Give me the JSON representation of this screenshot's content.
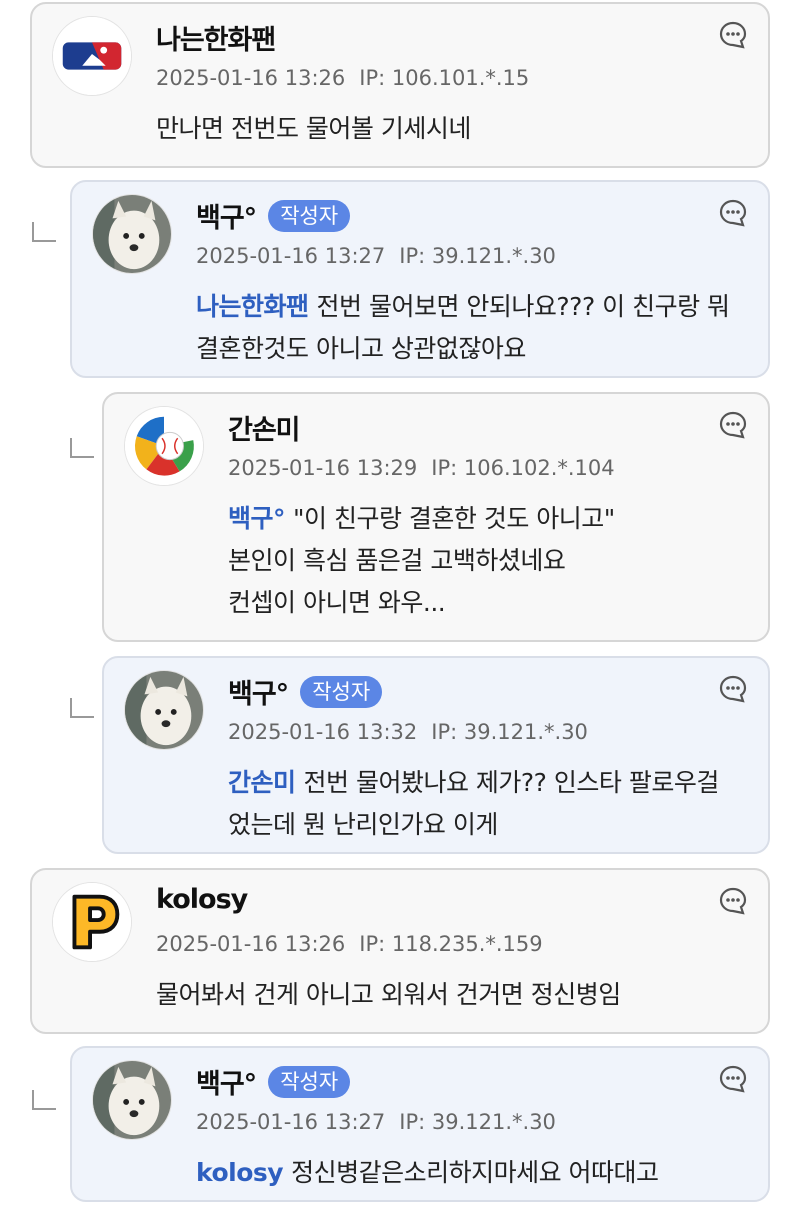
{
  "comments": [
    {
      "nick": "나는한화팬",
      "date": "2025-01-16 13:26",
      "ip": "IP: 106.101.*.15",
      "body": "만나면 전번도 물어볼 기세시네",
      "avatar": "mlb-logo"
    },
    {
      "nick": "백구°",
      "badge": "작성자",
      "date": "2025-01-16 13:27",
      "ip": "IP: 39.121.*.30",
      "mention": "나는한화팬",
      "body": "전번 물어보면 안되나요??? 이 친구랑 뭐 결혼한것도 아니고 상관없잖아요",
      "avatar": "white-dog-photo"
    },
    {
      "nick": "간손미",
      "date": "2025-01-16 13:29",
      "ip": "IP: 106.102.*.104",
      "mention": "백구°",
      "body_lines": [
        "\"이 친구랑 결혼한 것도 아니고\"",
        "본인이 흑심 품은걸 고백하셨네요",
        "컨셉이 아니면 와우..."
      ],
      "avatar": "world-baseball-classic-logo"
    },
    {
      "nick": "백구°",
      "badge": "작성자",
      "date": "2025-01-16 13:32",
      "ip": "IP: 39.121.*.30",
      "mention": "간손미",
      "body": "전번 물어봤나요 제가?? 인스타 팔로우걸었는데 뭔 난리인가요 이게",
      "avatar": "white-dog-photo"
    },
    {
      "nick": "kolosy",
      "date": "2025-01-16 13:26",
      "ip": "IP: 118.235.*.159",
      "body": "물어봐서 건게 아니고 외워서 건거면 정신병임",
      "avatar": "pirates-p-logo"
    },
    {
      "nick": "백구°",
      "badge": "작성자",
      "date": "2025-01-16 13:27",
      "ip": "IP: 39.121.*.30",
      "mention": "kolosy",
      "body": "정신병같은소리하지마세요 어따대고",
      "avatar": "white-dog-photo"
    }
  ],
  "icons": {
    "menu": "speech-bubble-more-icon",
    "reply": "reply-arrow-icon"
  },
  "colors": {
    "badge": "#5b86e5",
    "mention": "#2e5fc0",
    "reply_bg": "#f0f4fb",
    "comment_bg": "#f8f8f8"
  }
}
